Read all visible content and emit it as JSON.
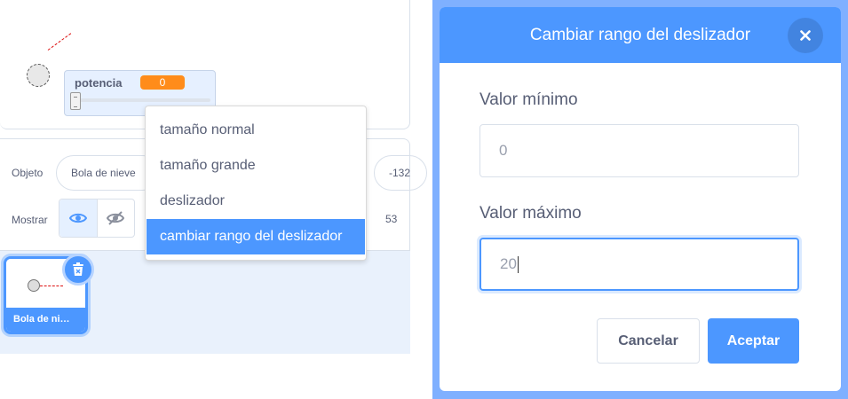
{
  "stage": {
    "slider": {
      "variable_name": "potencia",
      "value": "0",
      "level": 0
    }
  },
  "sprite_info": {
    "objeto_label": "Objeto",
    "sprite_name": "Bola de nieve",
    "x_value": "-132",
    "mostrar_label": "Mostrar",
    "size_value": "53",
    "show_visible_icon": "eye-icon",
    "show_hidden_icon": "eye-slash-icon"
  },
  "sprite_list": {
    "tiles": [
      {
        "name": "Bola de ni…"
      }
    ],
    "delete_icon": "trash-icon"
  },
  "context_menu": {
    "items": [
      {
        "label": "tamaño normal",
        "active": false
      },
      {
        "label": "tamaño grande",
        "active": false
      },
      {
        "label": "deslizador",
        "active": false
      },
      {
        "label": "cambiar rango del deslizador",
        "active": true
      }
    ]
  },
  "modal": {
    "title": "Cambiar rango del deslizador",
    "close_icon": "close-icon",
    "min_label": "Valor mínimo",
    "min_value": "0",
    "max_label": "Valor máximo",
    "max_value": "20",
    "cancel_label": "Cancelar",
    "ok_label": "Aceptar"
  },
  "colors": {
    "accent": "#4c97ff",
    "variable_orange": "#ff8c1a",
    "text": "#575e75"
  }
}
